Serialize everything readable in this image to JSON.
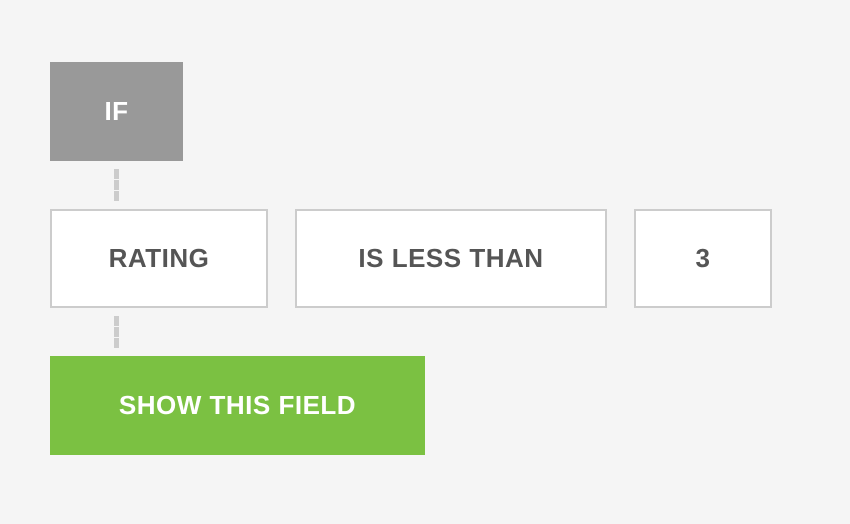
{
  "condition_logic": {
    "if_label": "IF",
    "field_label": "RATING",
    "operator_label": "IS LESS THAN",
    "value_label": "3",
    "action_label": "SHOW THIS FIELD"
  }
}
